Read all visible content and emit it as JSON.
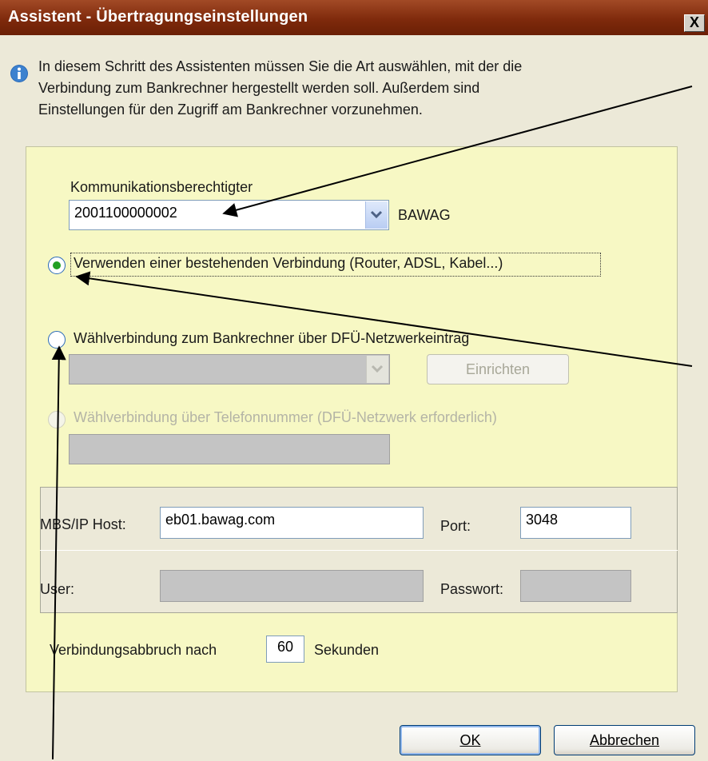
{
  "title": "Assistent - Übertragungseinstellungen",
  "close_label": "X",
  "info_lines": [
    "In diesem Schritt des Assistenten müssen Sie die Art auswählen, mit der die",
    "Verbindung zum Bankrechner hergestellt werden soll. Außerdem sind",
    "Einstellungen für den Zugriff am Bankrechner vorzunehmen."
  ],
  "kommunikation": {
    "label": "Kommunikationsberechtigter",
    "value": "2001100000002",
    "bank_name": "BAWAG"
  },
  "options": {
    "existing": "Verwenden einer bestehenden Verbindung (Router, ADSL, Kabel...)",
    "dialup_dfu": "Wählverbindung zum Bankrechner über DFÜ-Netzwerkeintrag",
    "setup_button": "Einrichten",
    "dialup_phone": "Wählverbindung  über Telefonnummer (DFÜ-Netzwerk erforderlich)"
  },
  "host": {
    "label": "MBS/IP Host:",
    "value": "eb01.bawag.com",
    "port_label": "Port:",
    "port_value": "3048"
  },
  "user": {
    "label": "User:",
    "password_label": "Passwort:"
  },
  "timeout": {
    "prefix": "Verbindungsabbruch nach",
    "value": "60",
    "suffix": "Sekunden"
  },
  "buttons": {
    "ok": "OK",
    "cancel": "Abbrechen"
  },
  "colors": {
    "titlebar": "#7f2a0c",
    "panel": "#f7f8c4",
    "dialog": "#ece9d8",
    "radio_selected": "#22a022",
    "info_icon": "#2a6ab8"
  }
}
